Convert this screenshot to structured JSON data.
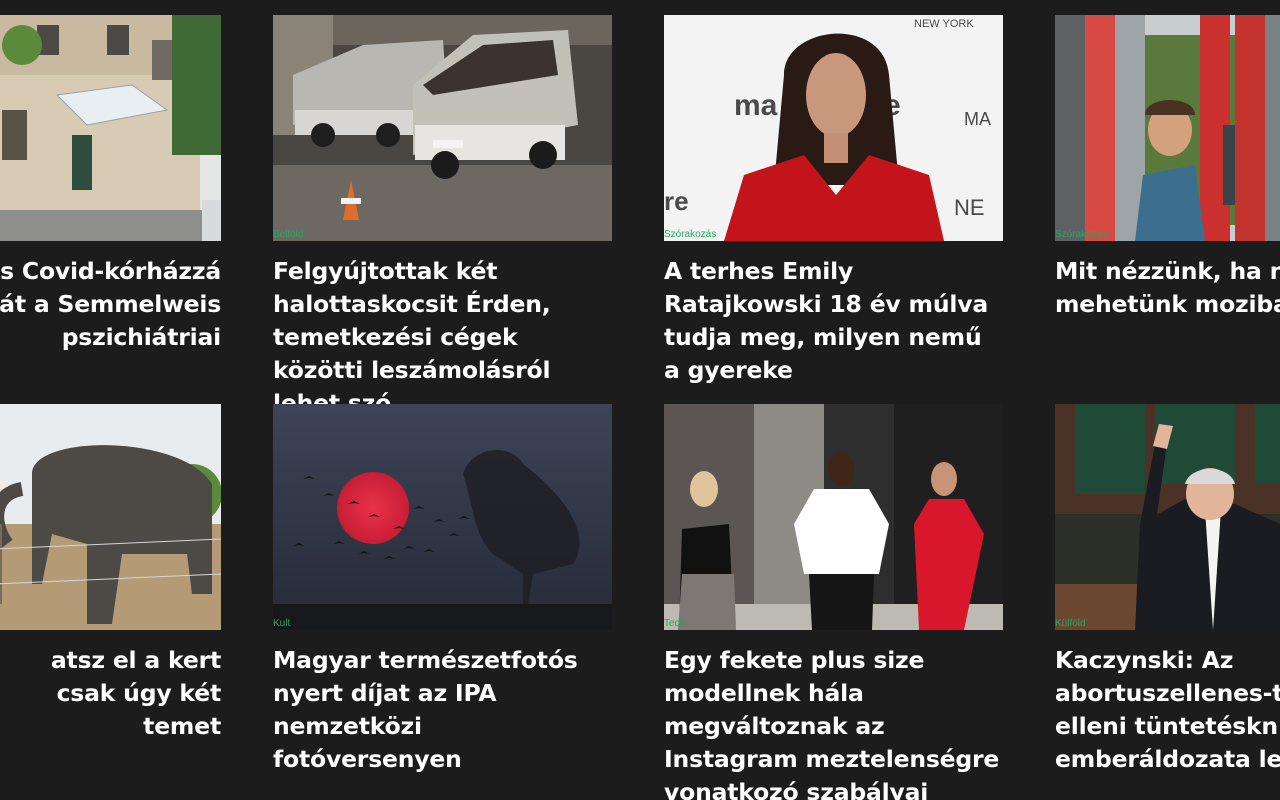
{
  "articles": [
    {
      "category": "",
      "title": "…s Covid-kórházzá alakítják át a Semmelweis …pszichiátriai",
      "title_visible": "s Covid-kórházzá\nát a Semmelweis\npszichiátriai",
      "image": "building-photo"
    },
    {
      "category": "Belföld",
      "title": "Felgyújtottak két halottaskocsit Érden, temetkezési cégek közötti leszámolásról lehet szó",
      "image": "burned-vans-photo"
    },
    {
      "category": "Szórakozás",
      "title": "A terhes Emily Ratajkowski 18 év múlva tudja meg, milyen nemű a gyereke",
      "image": "celebrity-red-dress-photo"
    },
    {
      "category": "Szórakozás",
      "title": "Mit nézzünk, ha ne mehetünk moziba",
      "title_visible": "Mit nézzünk, ha ne\nmehetünk moziba",
      "image": "phone-booth-photo"
    },
    {
      "category": "",
      "title": "tsz el a kert csak úgy két temet",
      "title_visible": "atsz el a kert\ncsak úgy két\ntemet",
      "image": "elephant-photo"
    },
    {
      "category": "Kult",
      "title": "Magyar természetfotós nyert díjat az IPA nemzetközi fotóversenyen",
      "image": "heron-sunset-photo"
    },
    {
      "category": "Tech",
      "title": "Egy fekete plus size modellnek hála megváltoznak az Instagram meztelenségre vonatkozó szabályai",
      "image": "three-women-photo"
    },
    {
      "category": "Külföld",
      "title": "Kaczynski: Az abortuszellenes-t elleni tüntetéskn emberáldozata les",
      "title_visible": "Kaczynski: Az\nabortuszellenes-t\nelleni tüntetéskn\nemberáldozata les",
      "image": "parliament-photo"
    }
  ]
}
